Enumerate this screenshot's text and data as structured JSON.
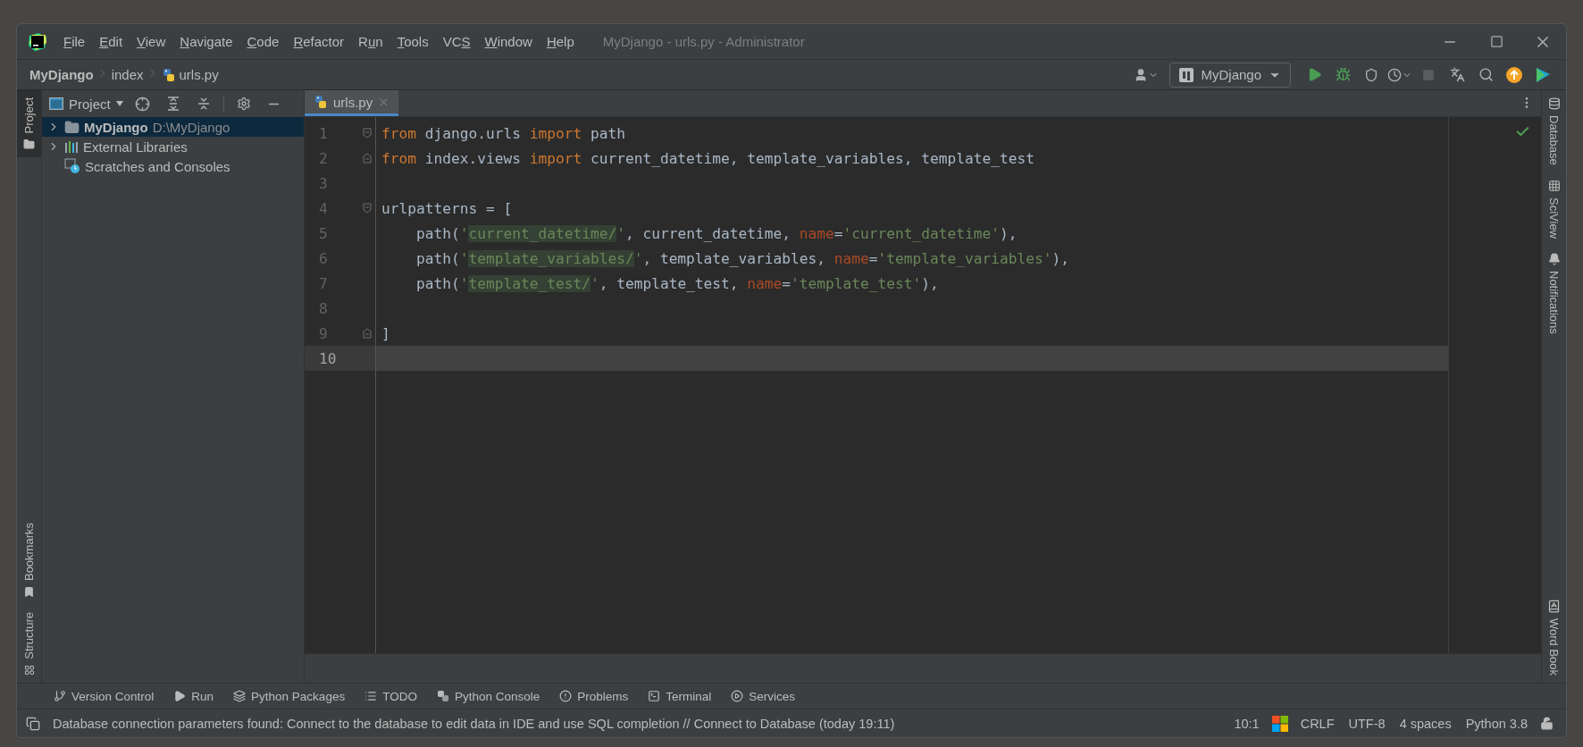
{
  "window": {
    "title": "MyDjango - urls.py - Administrator"
  },
  "menu": [
    {
      "key": "F",
      "post": "ile"
    },
    {
      "key": "E",
      "post": "dit"
    },
    {
      "key": "V",
      "post": "iew"
    },
    {
      "key": "N",
      "post": "avigate"
    },
    {
      "key": "C",
      "post": "ode"
    },
    {
      "key": "R",
      "post": "efactor"
    },
    {
      "pre": "R",
      "key": "u",
      "post": "n"
    },
    {
      "key": "T",
      "post": "ools"
    },
    {
      "pre": "VC",
      "key": "S"
    },
    {
      "key": "W",
      "post": "indow"
    },
    {
      "key": "H",
      "post": "elp"
    }
  ],
  "breadcrumbs": [
    {
      "label": "MyDjango",
      "kind": "project"
    },
    {
      "label": "index",
      "kind": "folder"
    },
    {
      "label": "urls.py",
      "kind": "python"
    }
  ],
  "run_config": {
    "label": "MyDjango"
  },
  "left_strip": [
    {
      "label": "Project",
      "selected": true,
      "kind": "top"
    },
    {
      "label": "Bookmarks",
      "selected": false,
      "kind": "bottom"
    },
    {
      "label": "Structure",
      "selected": false,
      "kind": "bottom"
    }
  ],
  "project_panel": {
    "title": "Project",
    "tree": [
      {
        "label": "MyDjango",
        "detail": "D:\\MyDjango",
        "kind": "folder",
        "expanded": false,
        "selected": true
      },
      {
        "label": "External Libraries",
        "kind": "library",
        "expanded": false,
        "selected": false
      },
      {
        "label": "Scratches and Consoles",
        "kind": "scratches",
        "selected": false
      }
    ]
  },
  "tabs": [
    {
      "label": "urls.py",
      "selected": true
    }
  ],
  "editor": {
    "lines": [
      {
        "number": "1",
        "kind": "fold_start",
        "current": false,
        "tokens": [
          {
            "t": "from",
            "kind": "kw"
          },
          {
            "t": " django.urls ",
            "kind": "plain"
          },
          {
            "t": "import",
            "kind": "kw"
          },
          {
            "t": " path",
            "kind": "plain"
          }
        ]
      },
      {
        "number": "2",
        "kind": "fold_end",
        "current": false,
        "tokens": [
          {
            "t": "from",
            "kind": "kw"
          },
          {
            "t": " index.views ",
            "kind": "plain"
          },
          {
            "t": "import",
            "kind": "kw"
          },
          {
            "t": " current_datetime, template_variables, template_test",
            "kind": "plain"
          }
        ]
      },
      {
        "number": "3",
        "kind": "plain",
        "current": false
      },
      {
        "number": "4",
        "kind": "fold_start",
        "current": false,
        "tokens": [
          {
            "t": "urlpatterns = [",
            "kind": "plain"
          }
        ]
      },
      {
        "number": "5",
        "kind": "plain",
        "current": false,
        "tokens": [
          {
            "t": "    path(",
            "kind": "plain"
          },
          {
            "t": "'",
            "kind": "str"
          },
          {
            "t": "current_datetime/",
            "kind": "strhl"
          },
          {
            "t": "'",
            "kind": "str"
          },
          {
            "t": ", current_datetime, ",
            "kind": "plain"
          },
          {
            "t": "name",
            "kind": "param"
          },
          {
            "t": "=",
            "kind": "plain"
          },
          {
            "t": "'current_datetime'",
            "kind": "str"
          },
          {
            "t": "),",
            "kind": "plain"
          }
        ]
      },
      {
        "number": "6",
        "kind": "plain",
        "current": false,
        "tokens": [
          {
            "t": "    path(",
            "kind": "plain"
          },
          {
            "t": "'",
            "kind": "str"
          },
          {
            "t": "template_variables/",
            "kind": "strhl"
          },
          {
            "t": "'",
            "kind": "str"
          },
          {
            "t": ", template_variables, ",
            "kind": "plain"
          },
          {
            "t": "name",
            "kind": "param"
          },
          {
            "t": "=",
            "kind": "plain"
          },
          {
            "t": "'template_variables'",
            "kind": "str"
          },
          {
            "t": "),",
            "kind": "plain"
          }
        ]
      },
      {
        "number": "7",
        "kind": "plain",
        "current": false,
        "tokens": [
          {
            "t": "    path(",
            "kind": "plain"
          },
          {
            "t": "'",
            "kind": "str"
          },
          {
            "t": "template_test/",
            "kind": "strhl"
          },
          {
            "t": "'",
            "kind": "str"
          },
          {
            "t": ", template_test, ",
            "kind": "plain"
          },
          {
            "t": "name",
            "kind": "param"
          },
          {
            "t": "=",
            "kind": "plain"
          },
          {
            "t": "'template_test'",
            "kind": "str"
          },
          {
            "t": "),",
            "kind": "plain"
          }
        ]
      },
      {
        "number": "8",
        "kind": "plain",
        "current": false
      },
      {
        "number": "9",
        "kind": "fold_end",
        "current": false,
        "tokens": [
          {
            "t": "]",
            "kind": "plain"
          }
        ]
      },
      {
        "number": "10",
        "kind": "plain",
        "current": true
      }
    ]
  },
  "right_strip": [
    {
      "label": "Database",
      "kind": "database"
    },
    {
      "label": "SciView",
      "kind": "grid"
    },
    {
      "label": "Notifications",
      "kind": "bell"
    },
    {
      "label": "Word Book",
      "kind": "book"
    }
  ],
  "tool_windows": [
    {
      "label": "Version Control",
      "kind": "vcs"
    },
    {
      "label": "Run",
      "kind": "run"
    },
    {
      "label": "Python Packages",
      "kind": "packages"
    },
    {
      "label": "TODO",
      "kind": "todo"
    },
    {
      "label": "Python Console",
      "kind": "console"
    },
    {
      "label": "Problems",
      "kind": "problems"
    },
    {
      "label": "Terminal",
      "kind": "terminal"
    },
    {
      "label": "Services",
      "kind": "services"
    }
  ],
  "status_bar": {
    "message": "Database connection parameters found: Connect to the database to edit data in IDE and use SQL completion // Connect to Database (today 19:11)",
    "items": [
      {
        "label": "10:1",
        "kind": "text"
      },
      {
        "kind": "windows"
      },
      {
        "label": "CRLF",
        "kind": "text"
      },
      {
        "label": "UTF-8",
        "kind": "text"
      },
      {
        "label": "4 spaces",
        "kind": "text"
      },
      {
        "label": "Python 3.8",
        "kind": "text"
      },
      {
        "kind": "lock"
      }
    ]
  }
}
